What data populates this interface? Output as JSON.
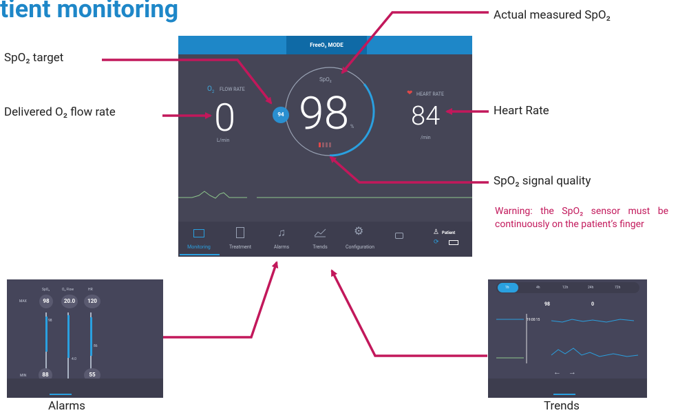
{
  "page": {
    "title": "tient monitoring"
  },
  "screen": {
    "mode": "FreeO₂ MODE",
    "flow_label": "FLOW RATE",
    "flow_value": "0",
    "flow_unit": "L/min",
    "spo2_label": "SpO₂",
    "spo2_value": "98",
    "spo2_unit": "%",
    "target_value": "94",
    "hr_label": "HEART RATE",
    "hr_value": "84",
    "hr_unit": "/min",
    "nav": [
      "Monitoring",
      "Treatment",
      "Alarms",
      "Trends",
      "Configuration"
    ],
    "patient_label": "Patient"
  },
  "callouts": {
    "spo2_target": "SpO₂ target",
    "flow_rate": "Delivered O₂ flow rate",
    "actual_spo2": "Actual measured SpO₂",
    "heart_rate": "Heart Rate",
    "signal_quality": "SpO₂ signal quality",
    "warning": "Warning: the SpO₂ sensor must be continuously on the patient’s finger"
  },
  "alarms_thumb": {
    "caption": "Alarms",
    "headers": [
      "SpO₂",
      "O₂ Flow",
      "HR"
    ],
    "max_label": "MAX",
    "min_label": "MIN",
    "values_top": [
      "98",
      "20.0",
      "120"
    ],
    "values_bottom": [
      "88",
      "55"
    ],
    "markers": [
      "98",
      "4.0",
      "86"
    ]
  },
  "trends_thumb": {
    "caption": "Trends",
    "tabs": [
      "1h",
      "4h",
      "12h",
      "24h",
      "72h"
    ],
    "spo2_value": "98",
    "flow_value": "0",
    "time": "19:00:15"
  },
  "colors": {
    "accent": "#1e87c8",
    "arrow": "#c2185b",
    "bg": "#454556"
  }
}
